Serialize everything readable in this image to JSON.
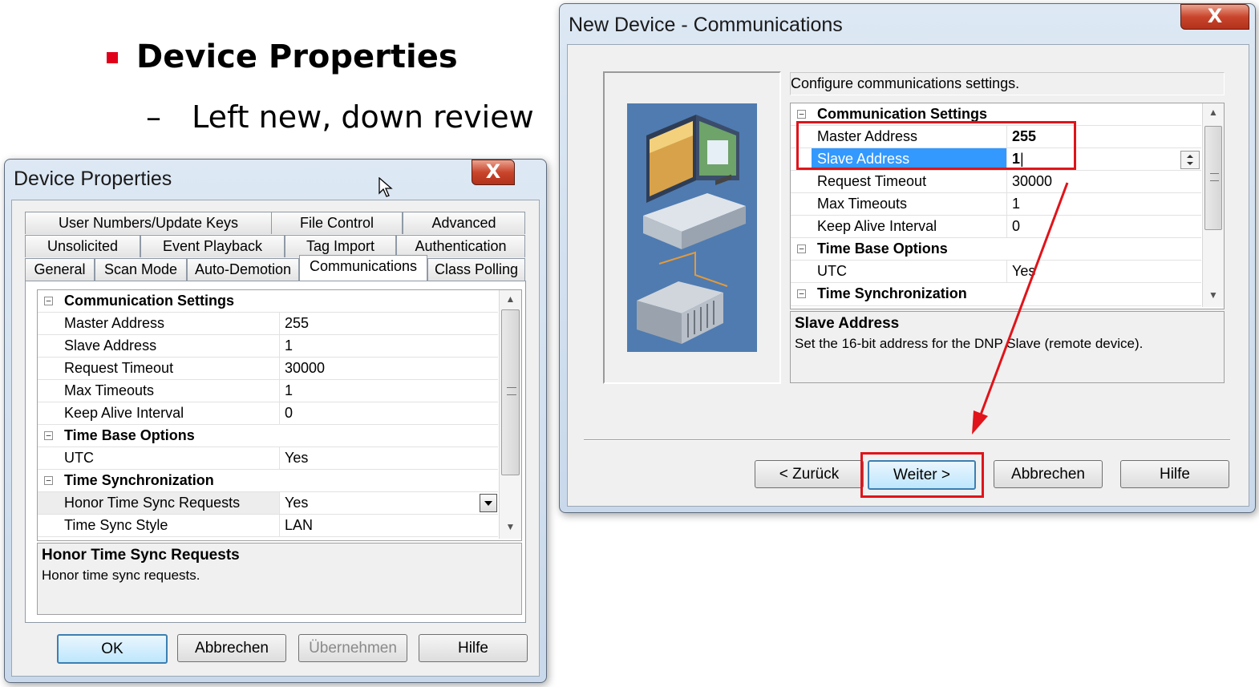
{
  "slide": {
    "title": "Device Properties",
    "subtitle_dash": "–",
    "subtitle": "Left new, down review",
    "accent_color": "#e0001a"
  },
  "left_dialog": {
    "title": "Device Properties",
    "close_glyph": "X",
    "tabs_row1": [
      "User Numbers/Update Keys",
      "File Control",
      "Advanced"
    ],
    "tabs_row2": [
      "Unsolicited",
      "Event Playback",
      "Tag Import",
      "Authentication"
    ],
    "tabs_row3": [
      "General",
      "Scan Mode",
      "Auto-Demotion",
      "Communications",
      "Class Polling"
    ],
    "active_tab": "Communications",
    "grid": {
      "cat1": "Communication Settings",
      "rows1": [
        {
          "name": "Master Address",
          "value": "255"
        },
        {
          "name": "Slave Address",
          "value": "1"
        },
        {
          "name": "Request Timeout",
          "value": "30000"
        },
        {
          "name": "Max Timeouts",
          "value": "1"
        },
        {
          "name": "Keep Alive Interval",
          "value": "0"
        }
      ],
      "cat2": "Time Base Options",
      "rows2": [
        {
          "name": "UTC",
          "value": "Yes"
        }
      ],
      "cat3": "Time Synchronization",
      "rows3": [
        {
          "name": "Honor Time Sync Requests",
          "value": "Yes"
        },
        {
          "name": "Time Sync Style",
          "value": "LAN"
        }
      ]
    },
    "description": {
      "title": "Honor Time Sync Requests",
      "text": "Honor time sync requests."
    },
    "buttons": {
      "ok": "OK",
      "cancel": "Abbrechen",
      "apply": "Übernehmen",
      "help": "Hilfe"
    }
  },
  "right_dialog": {
    "title": "New Device - Communications",
    "close_glyph": "X",
    "header_text": "Configure communications settings.",
    "grid": {
      "cat1": "Communication Settings",
      "rows1": [
        {
          "name": "Master Address",
          "value": "255"
        },
        {
          "name": "Slave Address",
          "value": "1"
        },
        {
          "name": "Request Timeout",
          "value": "30000"
        },
        {
          "name": "Max Timeouts",
          "value": "1"
        },
        {
          "name": "Keep Alive Interval",
          "value": "0"
        }
      ],
      "cat2": "Time Base Options",
      "rows2": [
        {
          "name": "UTC",
          "value": "Yes"
        }
      ],
      "cat3": "Time Synchronization"
    },
    "description": {
      "title": "Slave Address",
      "text": "Set the 16-bit address for the DNP Slave (remote device)."
    },
    "buttons": {
      "back": "< Zurück",
      "next": "Weiter >",
      "cancel": "Abbrechen",
      "help": "Hilfe"
    }
  },
  "colors": {
    "highlight": "#e0141a",
    "selection": "#3399ff",
    "close_button": "#c9452c"
  }
}
